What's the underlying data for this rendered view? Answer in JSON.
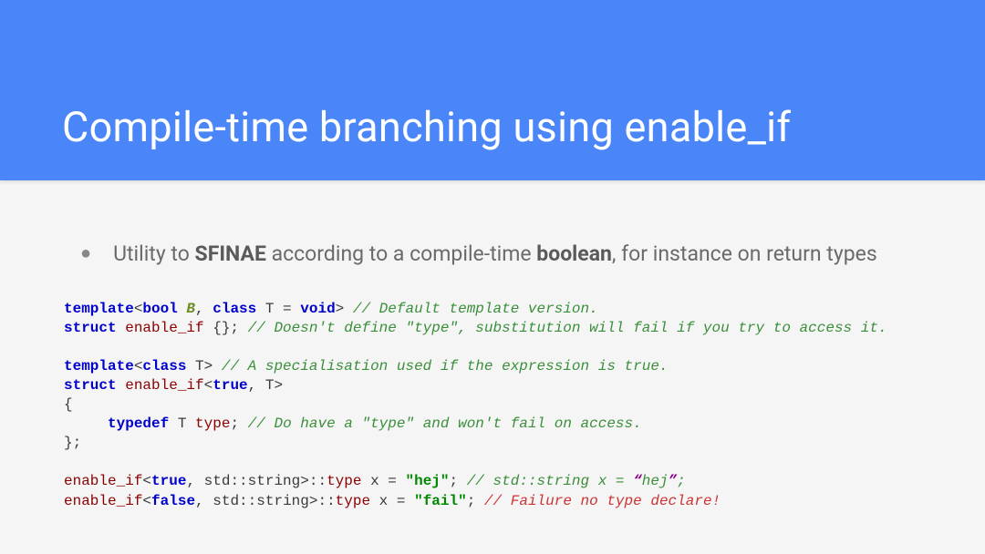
{
  "header": {
    "title": "Compile-time branching using enable_if"
  },
  "bullet": {
    "text_prefix": "Utility to ",
    "sfinae": "SFINAE",
    "text_mid": " according to a compile-time ",
    "boolean": "boolean",
    "text_suffix": ", for instance on return types"
  },
  "code": {
    "line1_kw_template": "template",
    "line1_lt": "<",
    "line1_kw_bool": "bool",
    "line1_b": " B",
    "line1_comma": ", ",
    "line1_kw_class": "class",
    "line1_t": " T = ",
    "line1_kw_void": "void",
    "line1_gt": "> ",
    "line1_comment": "// Default template version.",
    "line2_kw_struct": "struct",
    "line2_name": " enable_if",
    "line2_braces": " {}; ",
    "line2_comment": "// Doesn't define \"type\", substitution will fail if you try to access it.",
    "line4_kw_template": "template",
    "line4_lt": "<",
    "line4_kw_class": "class",
    "line4_t": " T> ",
    "line4_comment": "// A specialisation used if the expression is true.",
    "line5_kw_struct": "struct",
    "line5_name": " enable_if",
    "line5_lt": "<",
    "line5_true": "true",
    "line5_comma": ", T>",
    "line6_brace": "{",
    "line7_indent": "     ",
    "line7_kw_typedef": "typedef",
    "line7_t": " T ",
    "line7_type": "type",
    "line7_semi": "; ",
    "line7_comment": "// Do have a \"type\" and won't fail on access.",
    "line8_brace": "};",
    "line10_name": "enable_if",
    "line10_lt": "<",
    "line10_true": "true",
    "line10_std": ", std::string>::",
    "line10_type": "type",
    "line10_x": " x = ",
    "line10_str": "\"hej\"",
    "line10_semi": "; ",
    "line10_comment_pre": "// std::string x = ",
    "line10_comment_q1": "“",
    "line10_comment_hej": "hej",
    "line10_comment_q2": "”",
    "line10_comment_semi": ";",
    "line11_name": "enable_if",
    "line11_lt": "<",
    "line11_false": "false",
    "line11_std": ", std::string>::",
    "line11_type": "type",
    "line11_x": " x = ",
    "line11_str": "\"fail\"",
    "line11_semi": "; ",
    "line11_comment": "// Failure no type declare!"
  }
}
